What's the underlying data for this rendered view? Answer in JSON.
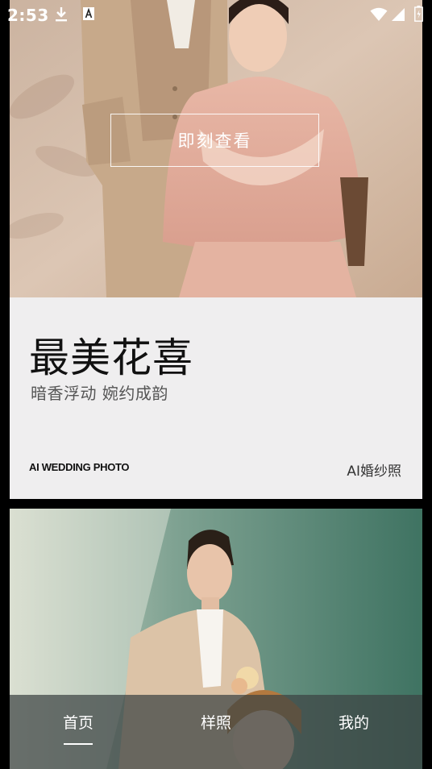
{
  "status_bar": {
    "time": "2:53",
    "left_icons": [
      "download-icon",
      "a-icon"
    ],
    "right_icons": [
      "wifi-icon",
      "signal-icon",
      "battery-icon"
    ]
  },
  "card1": {
    "view_button": "即刻查看",
    "title": "最美花喜",
    "subtitle": "暗香浮动 婉约成韵",
    "brand": "AI WEDDING PHOTO",
    "tag": "AI婚纱照"
  },
  "bottom_nav": {
    "items": [
      "首页",
      "样照",
      "我的"
    ],
    "active_index": 0
  },
  "colors": {
    "card_background": "#efeeef",
    "nav_background": "#3c4242",
    "photo1_wall": "#d9c2b0",
    "photo2_wall": "#5b8a7a"
  }
}
